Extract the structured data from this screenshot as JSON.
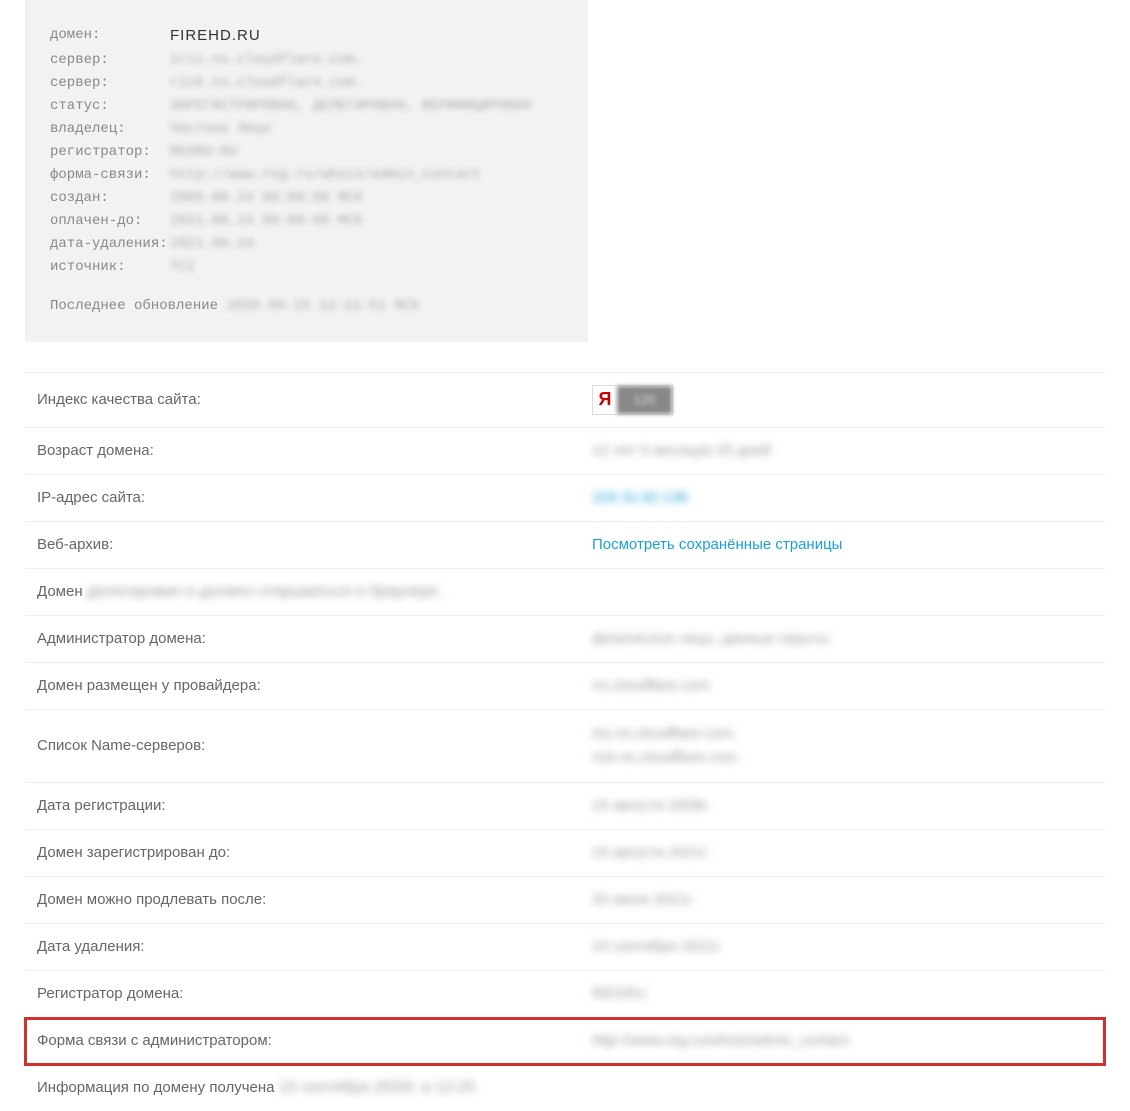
{
  "whois": {
    "domain_label": "домен:",
    "domain_value": "FIREHD.RU",
    "server1_label": "сервер:",
    "server1_value": "iris.ns.cloudflare.com.",
    "server2_label": "сервер:",
    "server2_value": "rick.ns.cloudflare.com.",
    "status_label": "статус:",
    "status_value": "ЗАРЕГИСТРИРОВАН, ДЕЛЕГИРОВАН, ВЕРИФИЦИРОВАН",
    "owner_label": "владелец:",
    "owner_value": "Частное Лицо",
    "registrar_label": "регистратор:",
    "registrar_value": "REGRU-RU",
    "contact_form_label": "форма-связи:",
    "contact_form_value": "http://www.reg.ru/whois/admin_contact",
    "created_label": "создан:",
    "created_value": "2008.08.24 00:00:00 МСК",
    "paid_till_label": "оплачен-до:",
    "paid_till_value": "2021.08.24 00:00:00 МСК",
    "delete_date_label": "дата-удаления:",
    "delete_date_value": "2021.09.24",
    "source_label": "источник:",
    "source_value": "TCI",
    "footer_text": "Последнее обновление ",
    "footer_date": "2020.09.15 12:21:51 МСК"
  },
  "info": {
    "quality_index_label": "Индекс качества сайта:",
    "yandex_letter": "Я",
    "yandex_score": "120",
    "domain_age_label": "Возраст домена:",
    "domain_age_value": "12 лет 0 месяцев 25 дней",
    "ip_label": "IP-адрес сайта:",
    "ip_value": "104.31.82.136",
    "webarchive_label": "Веб-архив:",
    "webarchive_link": "Посмотреть сохранённые страницы",
    "domain_status_prefix": "Домен ",
    "domain_status_value": "делегирован и должен открываться в браузере.",
    "admin_label": "Администратор домена:",
    "admin_value": "физическое лицо, данные скрыты",
    "provider_label": "Домен размещен у провайдера:",
    "provider_value": "ns.cloudflare.com",
    "ns_label": "Список Name-серверов:",
    "ns_value_1": "iris.ns.cloudflare.com.",
    "ns_value_2": "rick.ns.cloudflare.com.",
    "reg_date_label": "Дата регистрации:",
    "reg_date_value": "24 августа 2008г.",
    "reg_until_label": "Домен зарегистрирован до:",
    "reg_until_value": "24 августа 2021г.",
    "renew_after_label": "Домен можно продлевать после:",
    "renew_after_value": "25 июня 2021г.",
    "delete_date_label": "Дата удаления:",
    "delete_date_value": "24 сентября 2021г.",
    "registrar_label": "Регистратор домена:",
    "registrar_value": "REGRU",
    "contact_form_label": "Форма связи с администратором:",
    "contact_form_value": "http://www.reg.ru/whois/admin_contact",
    "footer_prefix": "Информация по домену получена ",
    "footer_date": "15 сентября 2020г. в 12:25"
  }
}
